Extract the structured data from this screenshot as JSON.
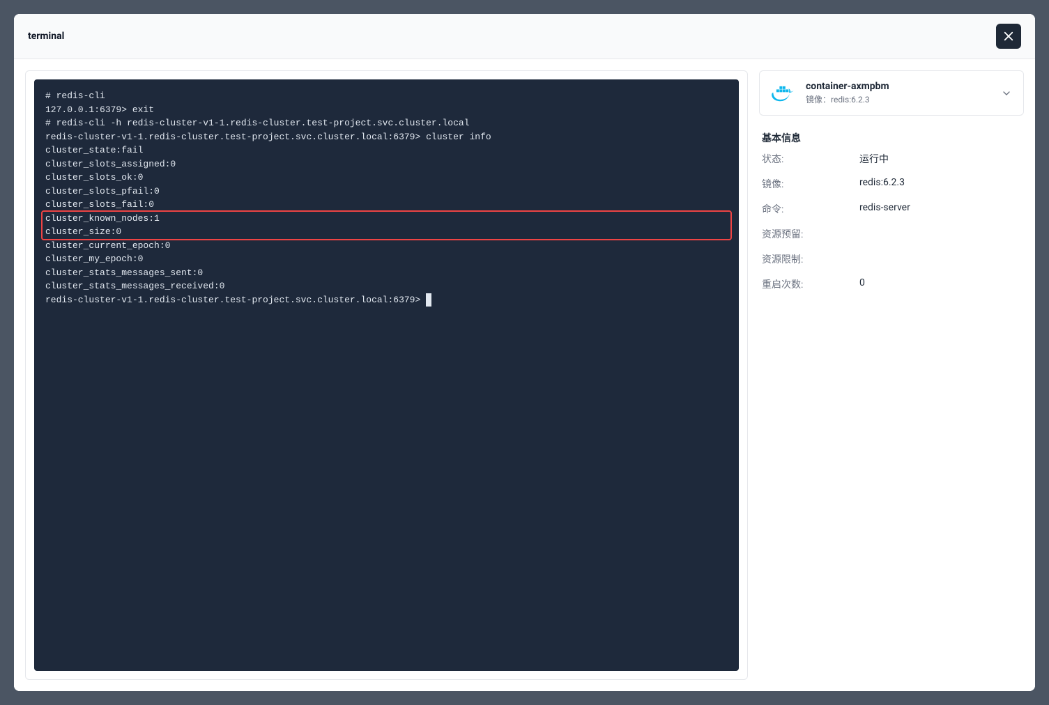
{
  "header": {
    "title": "terminal"
  },
  "terminal": {
    "lines": [
      "# redis-cli",
      "127.0.0.1:6379> exit",
      "# redis-cli -h redis-cluster-v1-1.redis-cluster.test-project.svc.cluster.local",
      "redis-cluster-v1-1.redis-cluster.test-project.svc.cluster.local:6379> cluster info",
      "cluster_state:fail",
      "cluster_slots_assigned:0",
      "cluster_slots_ok:0",
      "cluster_slots_pfail:0",
      "cluster_slots_fail:0",
      "cluster_known_nodes:1",
      "cluster_size:0",
      "cluster_current_epoch:0",
      "cluster_my_epoch:0",
      "cluster_stats_messages_sent:0",
      "cluster_stats_messages_received:0",
      "redis-cluster-v1-1.redis-cluster.test-project.svc.cluster.local:6379> "
    ],
    "highlight": {
      "from_line": 9,
      "to_line": 10
    }
  },
  "container": {
    "name": "container-axmpbm",
    "image_label_prefix": "镜像：",
    "image": "redis:6.2.3"
  },
  "info": {
    "section_title": "基本信息",
    "rows": [
      {
        "label": "状态:",
        "value": "运行中"
      },
      {
        "label": "镜像:",
        "value": "redis:6.2.3"
      },
      {
        "label": "命令:",
        "value": "redis-server"
      },
      {
        "label": "资源预留:",
        "value": ""
      },
      {
        "label": "资源限制:",
        "value": ""
      },
      {
        "label": "重启次数:",
        "value": "0"
      }
    ]
  },
  "colors": {
    "terminal_bg": "#1e293b",
    "highlight_border": "#ef4444",
    "close_bg": "#1f2937"
  }
}
